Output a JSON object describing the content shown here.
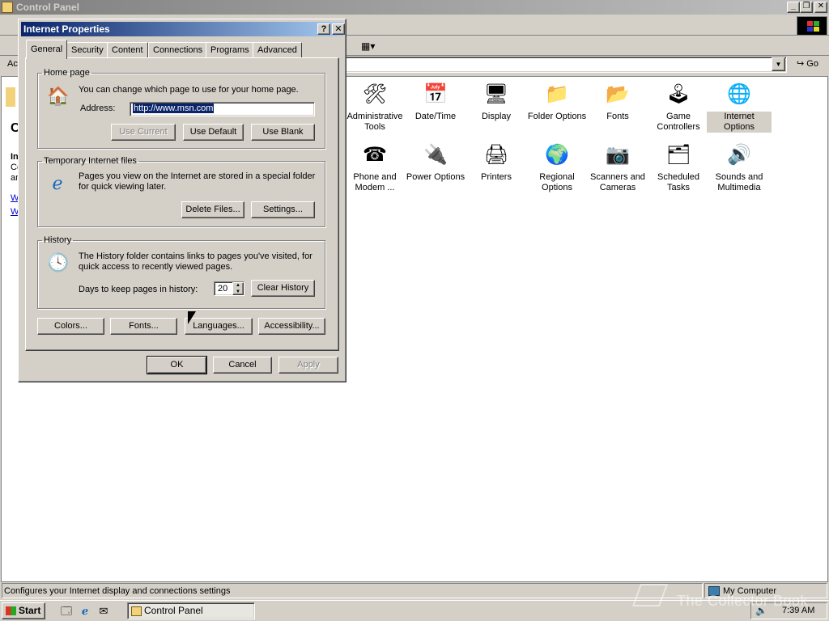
{
  "control_panel": {
    "title": "Control Panel",
    "address_label": "Ac",
    "go_label": "Go",
    "left_stub_letters": [
      "In",
      "Co",
      "an",
      "W",
      "W"
    ],
    "left_heading_letter": "C",
    "icons": [
      {
        "label": "Administrative Tools",
        "icon": "admin-tools-icon",
        "glyph": "🛠"
      },
      {
        "label": "Date/Time",
        "icon": "calendar-clock-icon",
        "glyph": "📅"
      },
      {
        "label": "Display",
        "icon": "monitor-icon",
        "glyph": "🖥"
      },
      {
        "label": "Folder Options",
        "icon": "folder-options-icon",
        "glyph": "📁"
      },
      {
        "label": "Fonts",
        "icon": "fonts-folder-icon",
        "glyph": "📂"
      },
      {
        "label": "Game Controllers",
        "icon": "joystick-icon",
        "glyph": "🕹"
      },
      {
        "label": "Internet Options",
        "icon": "globe-tools-icon",
        "glyph": "🌐"
      },
      {
        "label": "Phone and Modem ...",
        "icon": "phone-icon",
        "glyph": "☎"
      },
      {
        "label": "Power Options",
        "icon": "power-plug-icon",
        "glyph": "🔌"
      },
      {
        "label": "Printers",
        "icon": "printer-folder-icon",
        "glyph": "🖨"
      },
      {
        "label": "Regional Options",
        "icon": "globe-icon",
        "glyph": "🌍"
      },
      {
        "label": "Scanners and Cameras",
        "icon": "scanner-camera-icon",
        "glyph": "📷"
      },
      {
        "label": "Scheduled Tasks",
        "icon": "scheduled-tasks-folder-icon",
        "glyph": "🗂"
      },
      {
        "label": "Sounds and Multimedia",
        "icon": "speaker-icon",
        "glyph": "🔊"
      }
    ],
    "selected_icon": "Internet Options",
    "status_text": "Configures your Internet display and connections settings",
    "status_zone": "My Computer"
  },
  "dialog": {
    "title": "Internet Properties",
    "help_glyph": "?",
    "close_glyph": "✕",
    "tabs": [
      "General",
      "Security",
      "Content",
      "Connections",
      "Programs",
      "Advanced"
    ],
    "active_tab": "General",
    "home_page": {
      "legend": "Home page",
      "description": "You can change which page to use for your home page.",
      "address_label": "Address:",
      "address_value": "http://www.msn.com",
      "use_current": "Use Current",
      "use_default": "Use Default",
      "use_blank": "Use Blank"
    },
    "temp_files": {
      "legend": "Temporary Internet files",
      "description": "Pages you view on the Internet are stored in a special folder for quick viewing later.",
      "delete_files": "Delete Files...",
      "settings": "Settings..."
    },
    "history": {
      "legend": "History",
      "description": "The History folder contains links to pages you've visited, for quick access to recently viewed pages.",
      "days_label": "Days to keep pages in history:",
      "days_value": "20",
      "clear_history": "Clear History"
    },
    "bottom_buttons": {
      "colors": "Colors...",
      "fonts": "Fonts...",
      "languages": "Languages...",
      "accessibility": "Accessibility..."
    },
    "ok": "OK",
    "cancel": "Cancel",
    "apply": "Apply"
  },
  "taskbar": {
    "start_label": "Start",
    "task_label": "Control Panel",
    "clock": "7:39 AM"
  },
  "watermark": "The Collector Book"
}
